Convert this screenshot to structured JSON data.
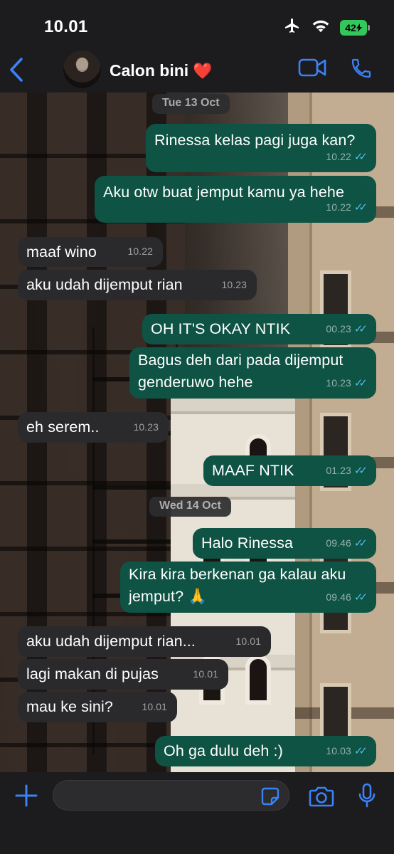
{
  "status_bar": {
    "time": "10.01",
    "battery": "42"
  },
  "header": {
    "contact_name": "Calon bini",
    "emoji": "❤️"
  },
  "colors": {
    "outgoing_bubble": "#0e5343",
    "incoming_bubble": "#2a2a2c",
    "accent": "#3b82f6",
    "read_ticks": "#53bdeb"
  },
  "date_pills": [
    "Tue 13 Oct",
    "Wed 14 Oct"
  ],
  "messages": [
    {
      "dir": "out",
      "text": "Rinessa kelas pagi juga kan?",
      "time": "10.22",
      "ticks": "✓✓"
    },
    {
      "dir": "out",
      "text": "Aku otw buat jemput kamu ya hehe",
      "time": "10.22",
      "ticks": "✓✓"
    },
    {
      "dir": "in",
      "text": "maaf wino",
      "time": "10.22"
    },
    {
      "dir": "in",
      "text": "aku udah dijemput rian",
      "time": "10.23"
    },
    {
      "dir": "out",
      "text": "OH IT'S OKAY NTIK",
      "time": "00.23",
      "ticks": "✓✓"
    },
    {
      "dir": "out",
      "line1": "Bagus deh dari pada dijemput",
      "line2": "genderuwo hehe",
      "time": "10.23",
      "ticks": "✓✓"
    },
    {
      "dir": "in",
      "text": "eh serem..",
      "time": "10.23"
    },
    {
      "dir": "out",
      "text": "MAAF NTIK",
      "time": "01.23",
      "ticks": "✓✓"
    },
    {
      "dir": "out",
      "text": "Halo Rinessa",
      "time": "09.46",
      "ticks": "✓✓"
    },
    {
      "dir": "out",
      "line1": "Kira kira berkenan ga kalau aku",
      "line2": "jemput? 🙏",
      "time": "09.46",
      "ticks": "✓✓"
    },
    {
      "dir": "in",
      "text": "aku udah dijemput rian...",
      "time": "10.01"
    },
    {
      "dir": "in",
      "text": "lagi makan di pujas",
      "time": "10.01"
    },
    {
      "dir": "in",
      "text": "mau ke sini?",
      "time": "10.01"
    },
    {
      "dir": "out",
      "text": "Oh ga dulu deh :)",
      "time": "10.03",
      "ticks": "✓✓"
    }
  ],
  "composer": {
    "value": ""
  },
  "icons": [
    "back-chevron-icon",
    "video-call-icon",
    "phone-icon",
    "plus-icon",
    "sticker-icon",
    "camera-icon",
    "microphone-icon",
    "airplane-icon",
    "wifi-icon"
  ]
}
